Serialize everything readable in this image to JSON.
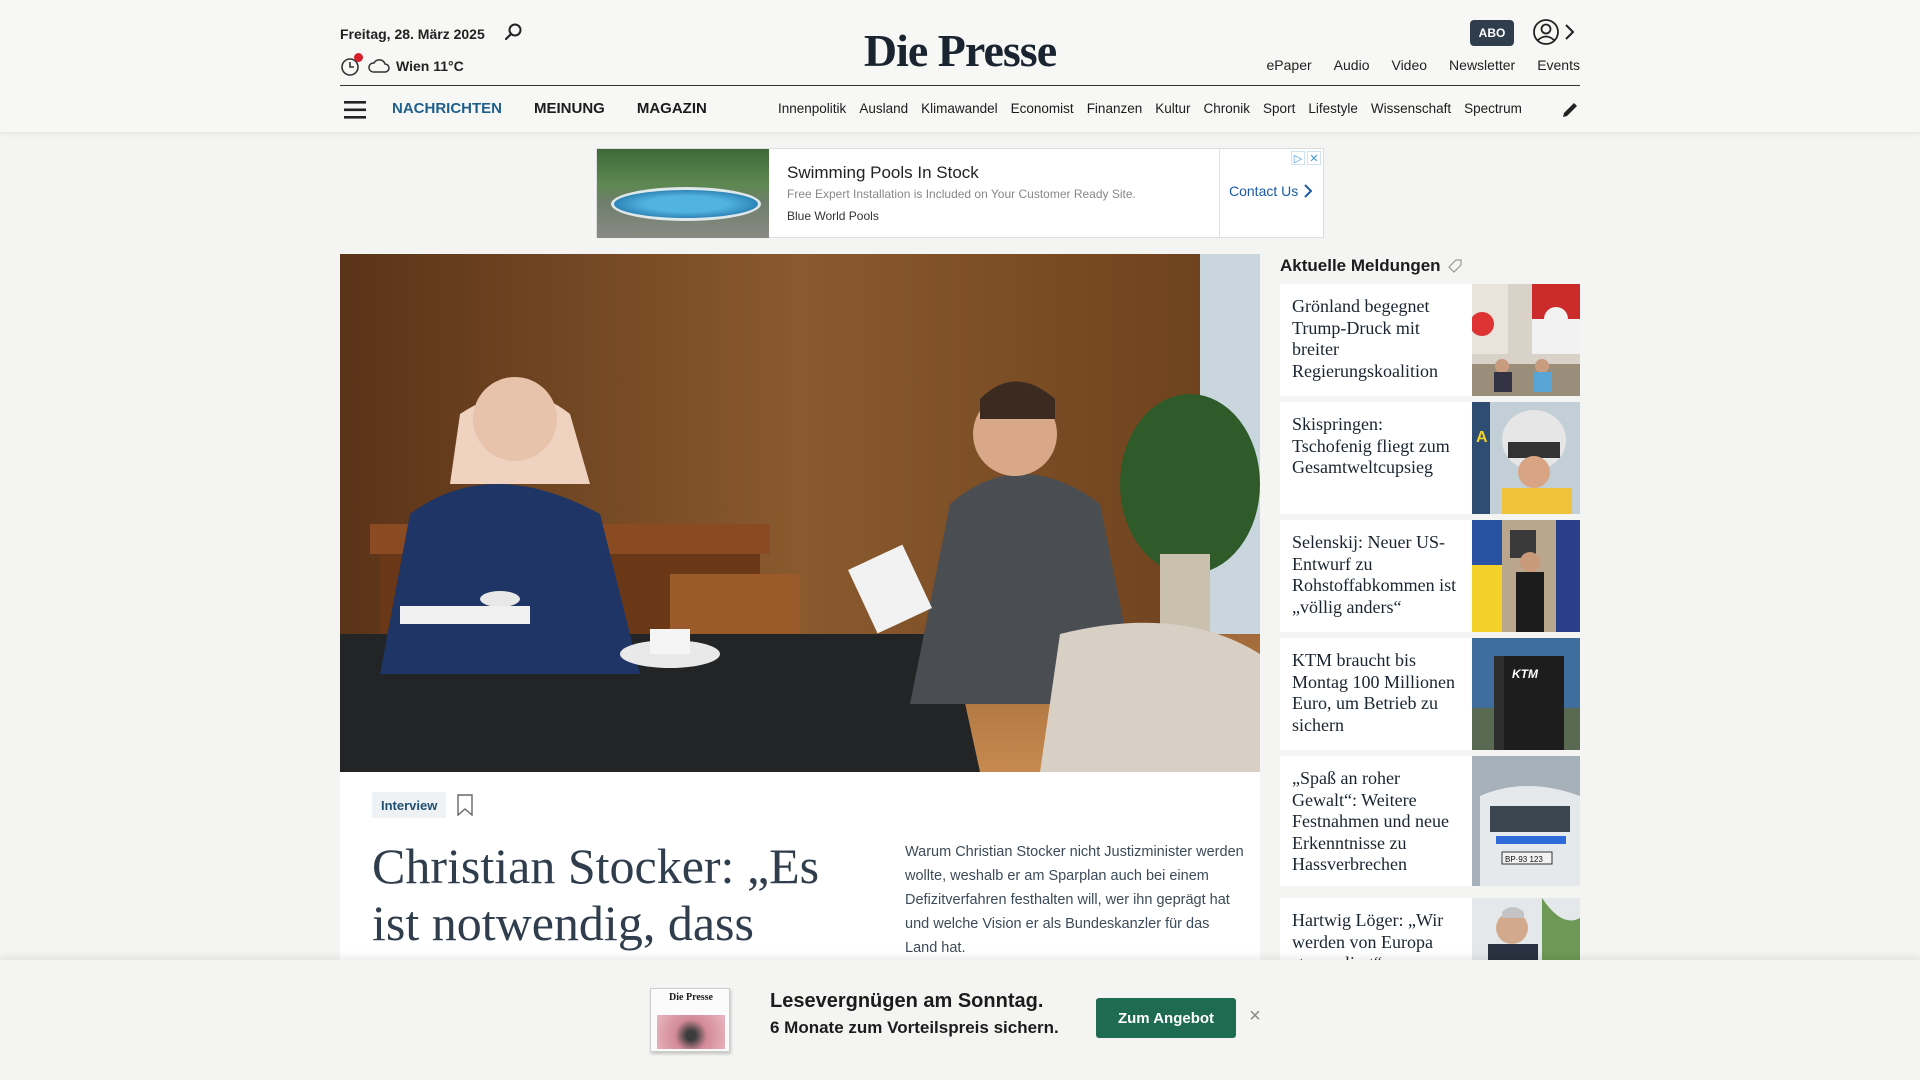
{
  "header": {
    "date": "Freitag, 28. März 2025",
    "weather": "Wien 11°C",
    "logo": "Die Presse",
    "abo_label": "ABO",
    "top_links": [
      "ePaper",
      "Audio",
      "Video",
      "Newsletter",
      "Events"
    ],
    "main_nav": [
      "NACHRICHTEN",
      "MEINUNG",
      "MAGAZIN"
    ],
    "sub_nav": [
      "Innenpolitik",
      "Ausland",
      "Klimawandel",
      "Economist",
      "Finanzen",
      "Kultur",
      "Chronik",
      "Sport",
      "Lifestyle",
      "Wissenschaft",
      "Spectrum"
    ]
  },
  "ad": {
    "title": "Swimming Pools In Stock",
    "description": "Free Expert Installation is Included on Your Customer Ready Site.",
    "brand": "Blue World Pools",
    "cta": "Contact Us"
  },
  "lead": {
    "tag": "Interview",
    "headline": "Christian Stocker: „Es ist notwendig, dass",
    "teaser": "Warum Christian Stocker nicht Justizminister werden wollte, weshalb er am Sparplan auch bei einem Defizitverfahren festhalten will, wer ihn geprägt hat und welche Vision er als Bundeskanzler für das Land hat."
  },
  "sidebar": {
    "title": "Aktuelle Meldungen",
    "items": [
      {
        "text": "Grönland begegnet Trump-Druck mit breiter Regierungskoalition"
      },
      {
        "text": "Skispringen: Tschofenig fliegt zum Gesamtweltcupsieg"
      },
      {
        "text": "Selenskij: Neuer US-Entwurf zu Rohstoffabkommen ist „völlig anders“"
      },
      {
        "text": "KTM braucht bis Montag 100 Millionen Euro, um Betrieb zu sichern"
      },
      {
        "text": "„Spaß an roher Gewalt“: Weitere Festnahmen und neue Erkenntnisse zu Hassverbrechen"
      },
      {
        "text": "Hartwig Löger: „Wir werden von Europa stranguliert“"
      }
    ]
  },
  "promo": {
    "mini_logo": "Die Presse",
    "headline": "Lesevergnügen am Sonntag.",
    "subline": "6 Monate zum Vorteilspreis sichern.",
    "button": "Zum Angebot",
    "close": "×"
  },
  "colors": {
    "brand_dark": "#2f3d4c",
    "nav_active": "#1f5f8b",
    "promo_button": "#1e6b52",
    "notification_dot": "#d81e2b"
  }
}
